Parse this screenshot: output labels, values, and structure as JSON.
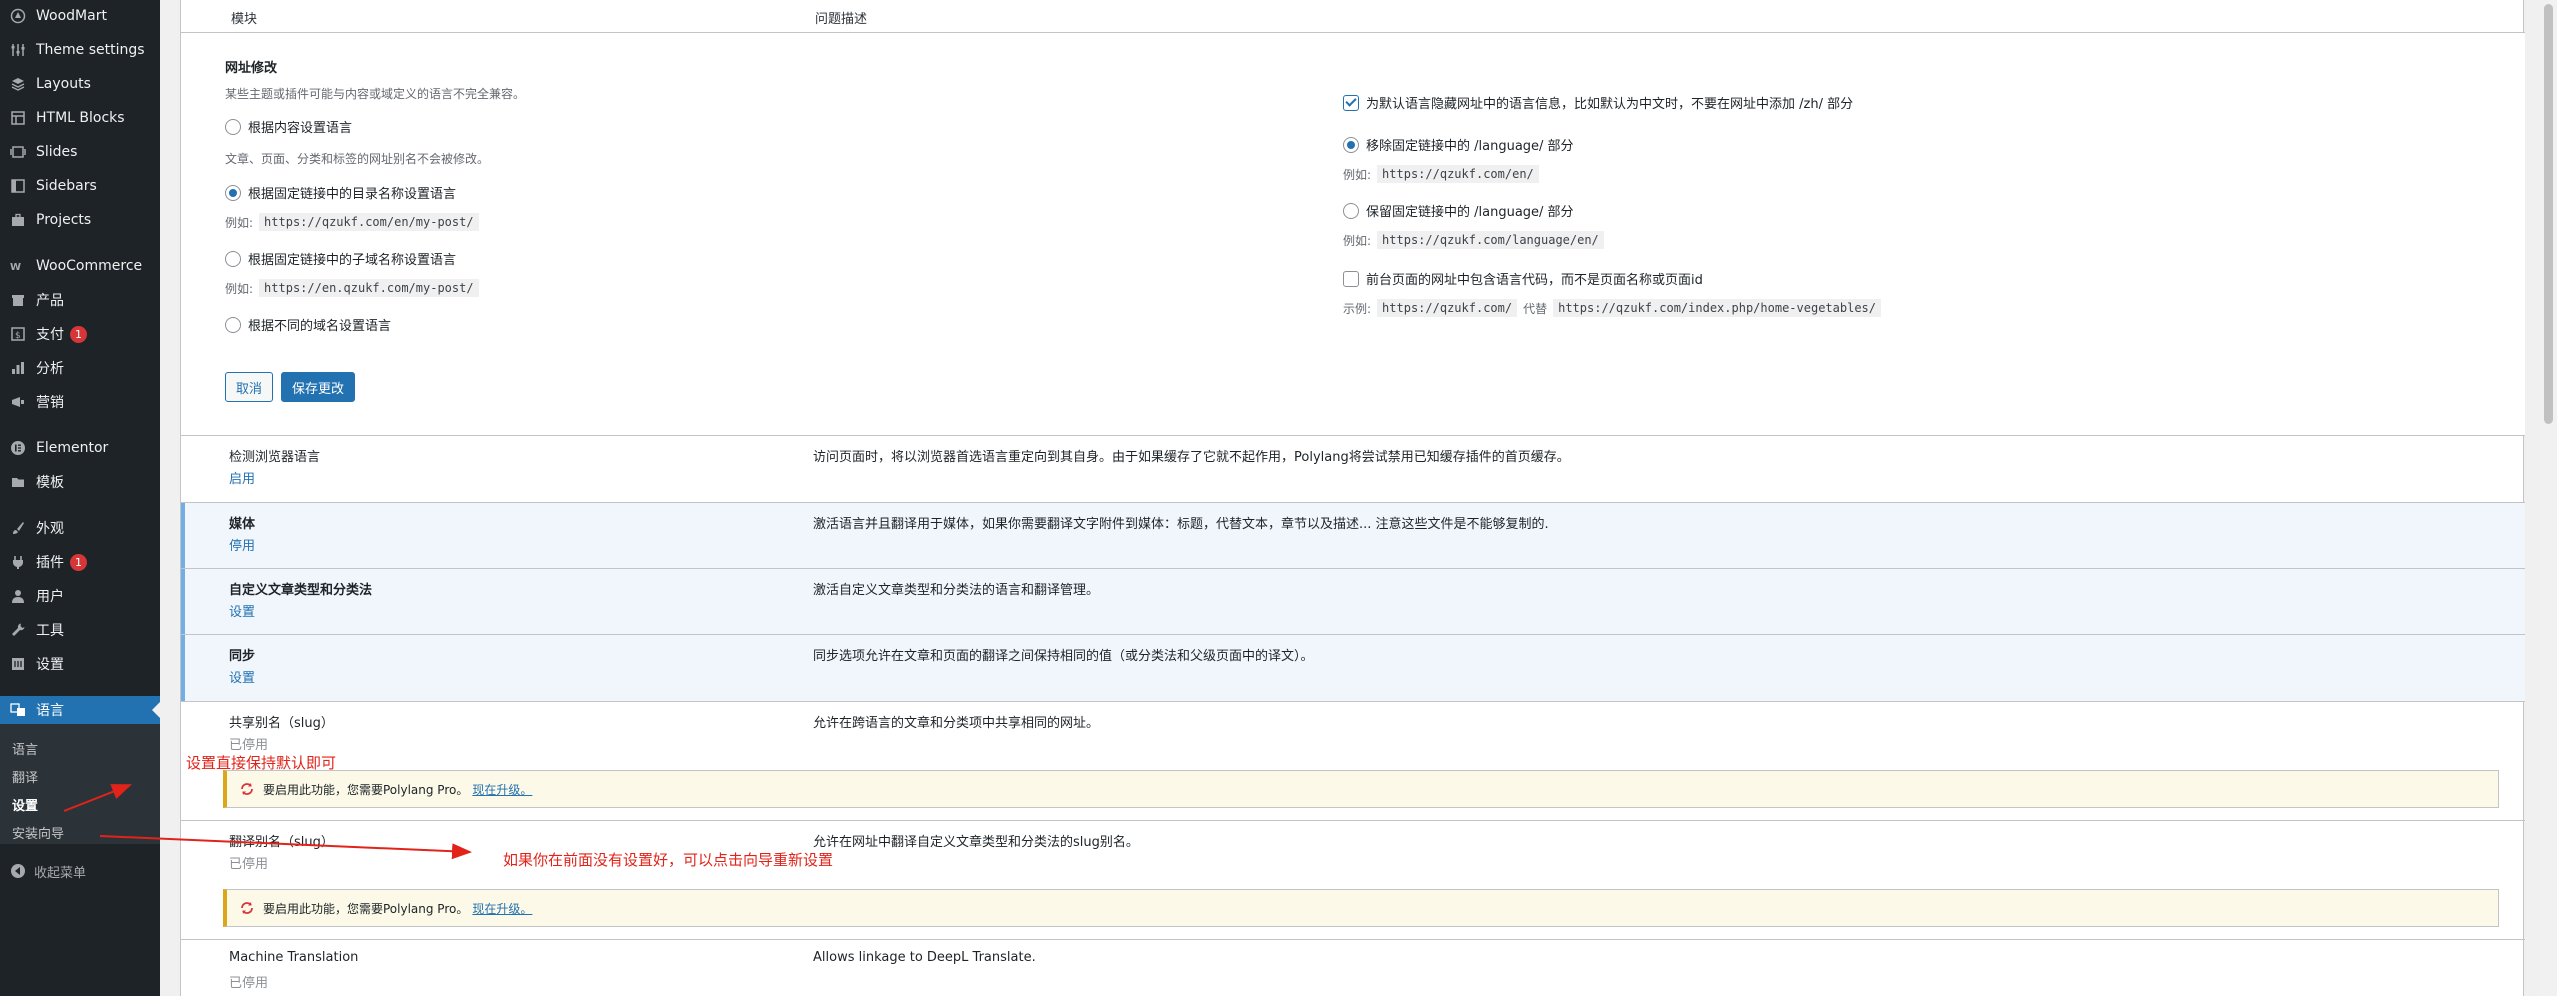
{
  "sidebar": {
    "items": [
      {
        "label": "WoodMart",
        "icon": "woodmart-icon"
      },
      {
        "label": "Theme settings",
        "icon": "sliders-icon"
      },
      {
        "label": "Layouts",
        "icon": "layers-icon"
      },
      {
        "label": "HTML Blocks",
        "icon": "blocks-icon"
      },
      {
        "label": "Slides",
        "icon": "slides-icon"
      },
      {
        "label": "Sidebars",
        "icon": "sidebars-icon"
      },
      {
        "label": "Projects",
        "icon": "briefcase-icon"
      },
      {
        "label": "WooCommerce",
        "icon": "woocommerce-icon"
      },
      {
        "label": "产品",
        "icon": "archive-icon"
      },
      {
        "label": "支付",
        "icon": "payment-icon",
        "badge": "1"
      },
      {
        "label": "分析",
        "icon": "bar-chart-icon"
      },
      {
        "label": "营销",
        "icon": "megaphone-icon"
      },
      {
        "label": "Elementor",
        "icon": "elementor-icon"
      },
      {
        "label": "模板",
        "icon": "folder-icon"
      },
      {
        "label": "外观",
        "icon": "paintbrush-icon"
      },
      {
        "label": "插件",
        "icon": "plugin-icon",
        "badge": "1"
      },
      {
        "label": "用户",
        "icon": "user-icon"
      },
      {
        "label": "工具",
        "icon": "wrench-icon"
      },
      {
        "label": "设置",
        "icon": "settings-icon"
      },
      {
        "label": "语言",
        "icon": "translation-icon"
      }
    ],
    "submenu": [
      "语言",
      "翻译",
      "设置",
      "安装向导"
    ],
    "collapse_label": "收起菜单",
    "active_color": "#2271b1"
  },
  "table_header": {
    "col1": "模块",
    "col2": "问题描述"
  },
  "url_settings": {
    "title": "网址修改",
    "warning": "某些主题或插件可能与内容或域定义的语言不完全兼容。",
    "opt_content": "根据内容设置语言",
    "content_note": "文章、页面、分类和标签的网址别名不会被修改。",
    "opt_directory": "根据固定链接中的目录名称设置语言",
    "example_label": "例如:",
    "example_directory": "https://qzukf.com/en/my-post/",
    "opt_subdomain": "根据固定链接中的子域名称设置语言",
    "example_subdomain": "https://en.qzukf.com/my-post/",
    "opt_domains": "根据不同的域名设置语言",
    "hide_default": "为默认语言隐藏网址中的语言信息，比如默认为中文时，不要在网址中添加 /zh/ 部分",
    "remove_language": "移除固定链接中的 /language/ 部分",
    "example_remove": "https://qzukf.com/en/",
    "keep_language": "保留固定链接中的 /language/ 部分",
    "example_keep": "https://qzukf.com/language/en/",
    "front_page": "前台页面的网址中包含语言代码，而不是页面名称或页面id",
    "front_example_label": "示例:",
    "front_example_1": "https://qzukf.com/",
    "front_example_mid": "代替",
    "front_example_2": "https://qzukf.com/index.php/home-vegetables/",
    "cancel": "取消",
    "save": "保存更改"
  },
  "modules": [
    {
      "title": "检测浏览器语言",
      "action": "启用",
      "desc": "访问页面时，将以浏览器首选语言重定向到其自身。由于如果缓存了它就不起作用，Polylang将尝试禁用已知缓存插件的首页缓存。"
    },
    {
      "title": "媒体",
      "action": "停用",
      "desc": "激活语言并且翻译用于媒体，如果你需要翻译文字附件到媒体：标题，代替文本，章节以及描述... 注意这些文件是不能够复制的."
    },
    {
      "title": "自定义文章类型和分类法",
      "action": "设置",
      "desc": "激活自定义文章类型和分类法的语言和翻译管理。"
    },
    {
      "title": "同步",
      "action": "设置",
      "desc": "同步选项允许在文章和页面的翻译之间保持相同的值（或分类法和父级页面中的译文）。"
    },
    {
      "title": "共享别名（slug）",
      "action": "已停用",
      "desc": "允许在跨语言的文章和分类项中共享相同的网址。"
    },
    {
      "title": "翻译别名（slug）",
      "action": "已停用",
      "desc": "允许在网址中翻译自定义文章类型和分类法的slug别名。"
    },
    {
      "title": "Machine Translation",
      "action": "已停用",
      "desc": "Allows linkage to DeepL Translate."
    }
  ],
  "notice": {
    "text": "要启用此功能，您需要Polylang Pro。",
    "link": "现在升级。"
  },
  "annotations": {
    "note1": "设置直接保持默认即可",
    "note2": "如果你在前面没有设置好，可以点击向导重新设置",
    "color": "#e2231a"
  }
}
